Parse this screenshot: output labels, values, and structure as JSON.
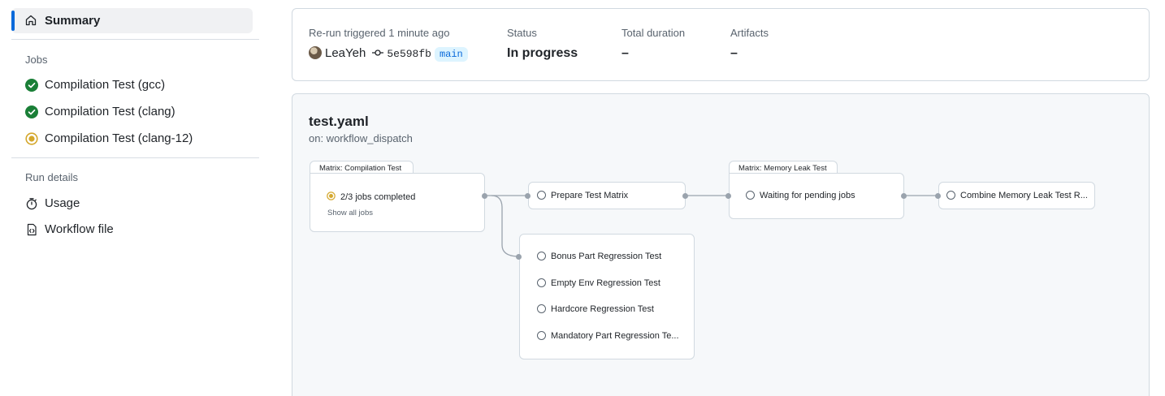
{
  "sidebar": {
    "summary_label": "Summary",
    "jobs_heading": "Jobs",
    "jobs": [
      {
        "label": "Compilation Test (gcc)",
        "status": "success"
      },
      {
        "label": "Compilation Test (clang)",
        "status": "success"
      },
      {
        "label": "Compilation Test (clang-12)",
        "status": "in_progress"
      }
    ],
    "run_details_heading": "Run details",
    "usage_label": "Usage",
    "workflow_file_label": "Workflow file"
  },
  "summary": {
    "trigger_label": "Re-run triggered 1 minute ago",
    "user": "LeaYeh",
    "commit_sha": "5e598fb",
    "branch": "main",
    "status_label": "Status",
    "status_value": "In progress",
    "duration_label": "Total duration",
    "duration_value": "–",
    "artifacts_label": "Artifacts",
    "artifacts_value": "–"
  },
  "graph": {
    "workflow_name": "test.yaml",
    "trigger": "on: workflow_dispatch",
    "matrix_compilation": {
      "tab_label": "Matrix: Compilation Test",
      "progress_text": "2/3 jobs completed",
      "show_all": "Show all jobs"
    },
    "prepare_job": "Prepare Test Matrix",
    "regression_jobs": [
      "Bonus Part Regression Test",
      "Empty Env Regression Test",
      "Hardcore Regression Test",
      "Mandatory Part Regression Te..."
    ],
    "matrix_memory": {
      "tab_label": "Matrix: Memory Leak Test",
      "waiting_text": "Waiting for pending jobs"
    },
    "combine_job": "Combine Memory Leak Test R..."
  },
  "colors": {
    "accent": "#0969da",
    "success": "#1a7f37",
    "in_progress": "#bf8700",
    "muted": "#59636e"
  }
}
